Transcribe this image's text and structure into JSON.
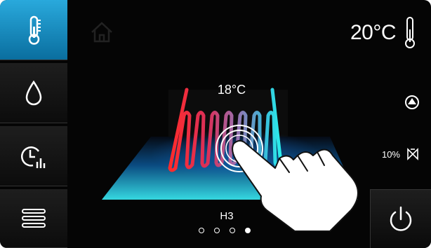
{
  "sidebar": {
    "items": [
      {
        "name": "temperature",
        "icon": "thermometer-icon",
        "active": true
      },
      {
        "name": "water",
        "icon": "water-drop-icon",
        "active": false
      },
      {
        "name": "schedule",
        "icon": "clock-bars-icon",
        "active": false
      },
      {
        "name": "menu",
        "icon": "hamburger-menu-icon",
        "active": false
      }
    ]
  },
  "status": {
    "room_temperature": "20°C",
    "pump_icon": "pump-icon",
    "valve_percent": "10%",
    "valve_icon": "valve-icon"
  },
  "main": {
    "setpoint": "18°C",
    "mode": "H3",
    "page_count": 4,
    "active_page": 4,
    "home_icon": "home-icon",
    "heater_icon": "heating-coil-icon",
    "touch_icon": "hand-pointer-icon"
  },
  "power": {
    "icon": "power-icon"
  },
  "colors": {
    "accent": "#29a9dc",
    "hot": "#e8323c",
    "cold": "#2ee6e6",
    "background": "#050505"
  }
}
